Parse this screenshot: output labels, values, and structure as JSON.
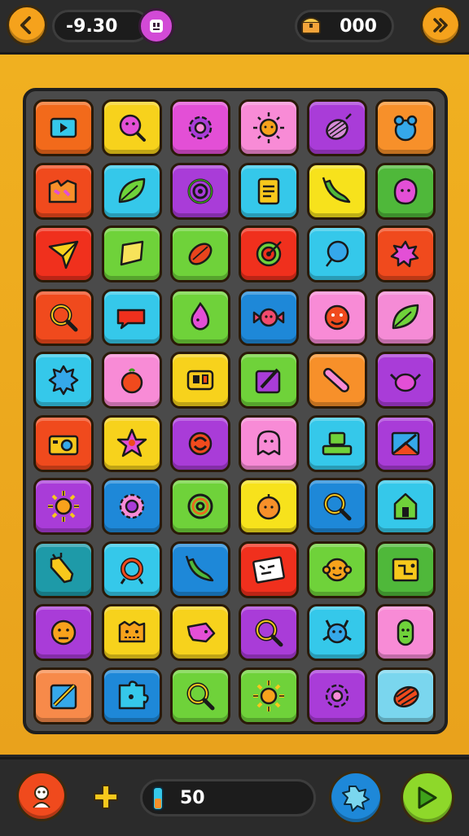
{
  "header": {
    "left_value": "-9.30",
    "right_value": "000",
    "back_icon": "chevron-left-icon",
    "forward_icon": "double-chevron-right-icon",
    "center_icon": "robot-face-icon",
    "chest_icon": "treasure-chest-icon"
  },
  "footer": {
    "counter_value": "50",
    "player_icon": "character-icon",
    "plus_icon": "plus-icon",
    "battery_icon": "battery-icon",
    "splat_icon": "splat-icon",
    "play_icon": "play-icon"
  },
  "grid": {
    "rows": 10,
    "cols": 6,
    "tiles": [
      {
        "color": "#f26a1b",
        "icon": "play-box-icon"
      },
      {
        "color": "#f7d21c",
        "icon": "magnifier-face-icon"
      },
      {
        "color": "#e34fd6",
        "icon": "gear-icon"
      },
      {
        "color": "#f88bd6",
        "icon": "sun-face-icon"
      },
      {
        "color": "#a93cd8",
        "icon": "onion-icon"
      },
      {
        "color": "#f7902a",
        "icon": "berry-icon"
      },
      {
        "color": "#f04a1d",
        "icon": "torn-box-icon"
      },
      {
        "color": "#35c8ea",
        "icon": "leaf-icon"
      },
      {
        "color": "#a93cd8",
        "icon": "swirl-icon"
      },
      {
        "color": "#35c8ea",
        "icon": "document-icon"
      },
      {
        "color": "#f7e21c",
        "icon": "pepper-icon"
      },
      {
        "color": "#4fb83a",
        "icon": "blob-face-icon"
      },
      {
        "color": "#f0301d",
        "icon": "paper-plane-icon"
      },
      {
        "color": "#6fd23a",
        "icon": "diamond-icon"
      },
      {
        "color": "#6fd23a",
        "icon": "seed-icon"
      },
      {
        "color": "#f0301d",
        "icon": "target-icon"
      },
      {
        "color": "#35c8ea",
        "icon": "balloon-icon"
      },
      {
        "color": "#f04a1d",
        "icon": "star-burst-icon"
      },
      {
        "color": "#f04a1d",
        "icon": "magnifier-icon"
      },
      {
        "color": "#35c8ea",
        "icon": "speech-bubble-icon"
      },
      {
        "color": "#6fd23a",
        "icon": "droplet-face-icon"
      },
      {
        "color": "#1e88d8",
        "icon": "candy-face-icon"
      },
      {
        "color": "#f88bd6",
        "icon": "smile-face-icon"
      },
      {
        "color": "#f58bd6",
        "icon": "leaf-icon"
      },
      {
        "color": "#35c8ea",
        "icon": "splat-icon"
      },
      {
        "color": "#f88bd6",
        "icon": "tomato-icon"
      },
      {
        "color": "#f7d21c",
        "icon": "card-icon"
      },
      {
        "color": "#6fd23a",
        "icon": "pencil-box-icon"
      },
      {
        "color": "#f7902a",
        "icon": "bone-icon"
      },
      {
        "color": "#a93cd8",
        "icon": "teapot-icon"
      },
      {
        "color": "#f04a1d",
        "icon": "camera-icon"
      },
      {
        "color": "#f7d21c",
        "icon": "star-icon"
      },
      {
        "color": "#a93cd8",
        "icon": "recycle-icon"
      },
      {
        "color": "#f88bd6",
        "icon": "ghost-face-icon"
      },
      {
        "color": "#35c8ea",
        "icon": "computer-icon"
      },
      {
        "color": "#a93cd8",
        "icon": "picture-icon"
      },
      {
        "color": "#a93cd8",
        "icon": "sun-icon"
      },
      {
        "color": "#1e88d8",
        "icon": "flower-icon"
      },
      {
        "color": "#6fd23a",
        "icon": "spiral-icon"
      },
      {
        "color": "#f7e21c",
        "icon": "orange-face-icon"
      },
      {
        "color": "#1e88d8",
        "icon": "magnifier-icon"
      },
      {
        "color": "#35c8ea",
        "icon": "house-icon"
      },
      {
        "color": "#1e9aa8",
        "icon": "ticket-icon"
      },
      {
        "color": "#35c8ea",
        "icon": "ring-icon"
      },
      {
        "color": "#1e88d8",
        "icon": "pepper-icon"
      },
      {
        "color": "#f0301d",
        "icon": "note-icon"
      },
      {
        "color": "#6fd23a",
        "icon": "monkey-face-icon"
      },
      {
        "color": "#4fb83a",
        "icon": "circuit-icon"
      },
      {
        "color": "#a93cd8",
        "icon": "sad-face-icon"
      },
      {
        "color": "#f7d21c",
        "icon": "face-box-icon"
      },
      {
        "color": "#f7d21c",
        "icon": "fish-icon"
      },
      {
        "color": "#a93cd8",
        "icon": "magnifier-icon"
      },
      {
        "color": "#35c8ea",
        "icon": "monster-icon"
      },
      {
        "color": "#f88bd6",
        "icon": "pickle-icon"
      },
      {
        "color": "#f78a4a",
        "icon": "pencil-icon"
      },
      {
        "color": "#1e88d8",
        "icon": "puzzle-icon"
      },
      {
        "color": "#6fd23a",
        "icon": "magnifier-icon"
      },
      {
        "color": "#6fd23a",
        "icon": "sun-icon"
      },
      {
        "color": "#a93cd8",
        "icon": "gear-icon"
      },
      {
        "color": "#7ad6ee",
        "icon": "shell-icon"
      }
    ]
  }
}
